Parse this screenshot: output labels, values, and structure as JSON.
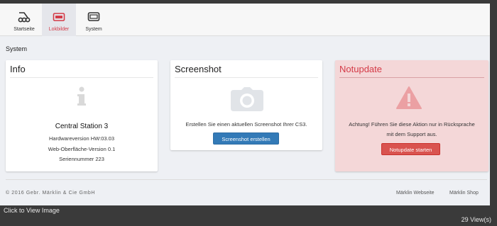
{
  "nav": {
    "items": [
      {
        "label": "Startseite",
        "icon": "track-switch-icon"
      },
      {
        "label": "Lokbilder",
        "icon": "loco-image-icon"
      },
      {
        "label": "System",
        "icon": "system-monitor-icon"
      }
    ],
    "active_color": "#d43a47"
  },
  "page": {
    "title": "System"
  },
  "info": {
    "title": "Info",
    "icon": "info-icon",
    "device": "Central Station 3",
    "hardware": "Hardwareversion HW:03.03",
    "web": "Web-Oberfläche-Version 0.1",
    "serial": "Seriennummer 223"
  },
  "screenshot": {
    "title": "Screenshot",
    "icon": "camera-icon",
    "text": "Erstellen Sie einen aktuellen Screenshot Ihrer CS3.",
    "button": "Screenshot erstellen",
    "button_color": "#337ab7"
  },
  "notupdate": {
    "title": "Notupdate",
    "icon": "warning-icon",
    "text_line1": "Achtung! Führen Sie diese Aktion nur in Rücksprache",
    "text_line2": "mit dem Support aus.",
    "button": "Notupdate starten",
    "button_color": "#d9534f",
    "card_color": "#f4d7d8"
  },
  "footer": {
    "copyright": "© 2016 Gebr. Märklin & Cie GmbH",
    "links": [
      "Märklin Webseite",
      "Märklin Shop"
    ]
  },
  "viewer": {
    "caption": "Click to View Image",
    "views": "29 View(s)"
  }
}
